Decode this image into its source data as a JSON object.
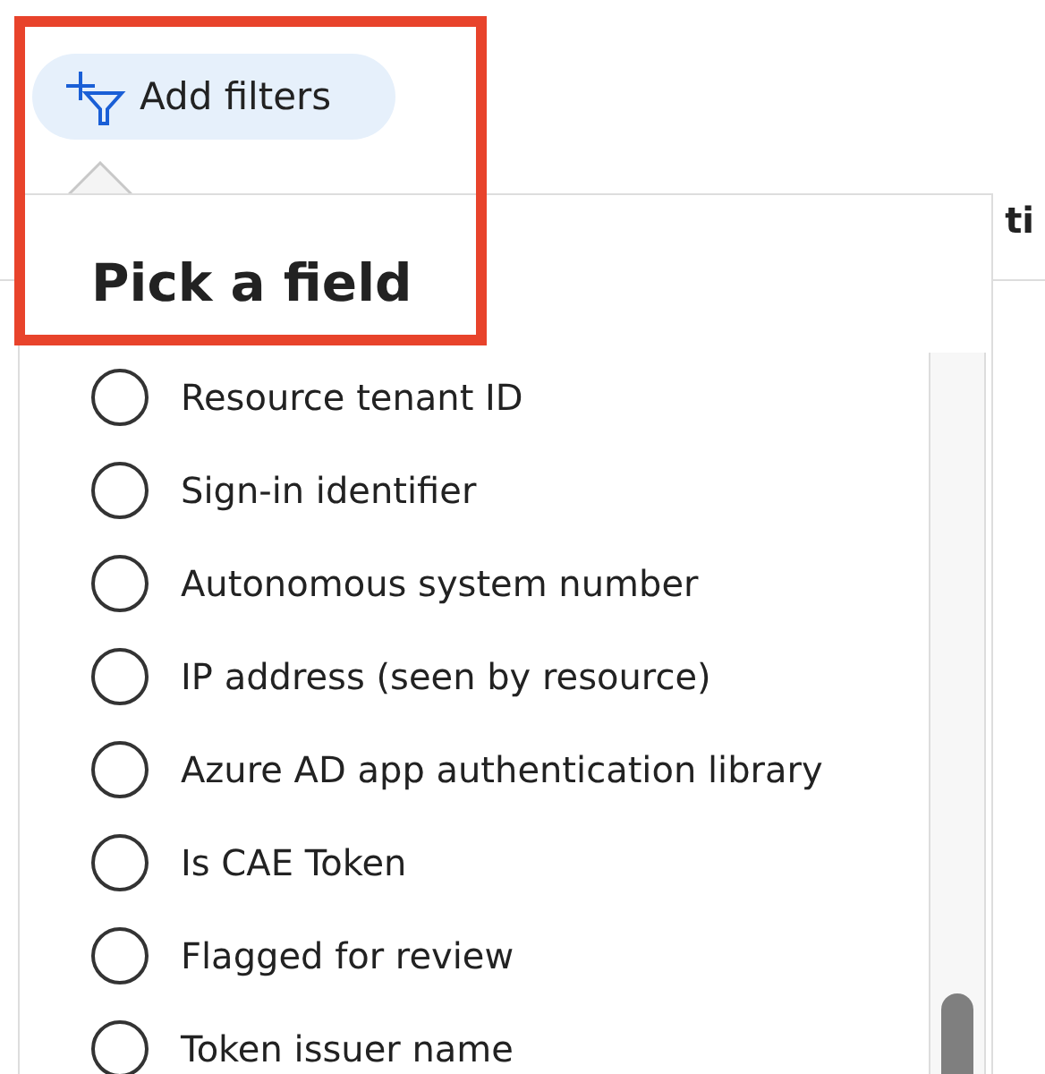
{
  "toolbar": {
    "add_filters_button": "Add filters"
  },
  "table": {
    "column_header": "ti"
  },
  "popup": {
    "title": "Pick a field",
    "options": [
      {
        "label": "Resource tenant ID",
        "selected": false
      },
      {
        "label": "Sign-in identifier",
        "selected": false
      },
      {
        "label": "Autonomous system number",
        "selected": false
      },
      {
        "label": "IP address (seen by resource)",
        "selected": false
      },
      {
        "label": "Azure AD app authentication library",
        "selected": false
      },
      {
        "label": "Is CAE Token",
        "selected": false
      },
      {
        "label": "Flagged for review",
        "selected": false
      },
      {
        "label": "Token issuer name",
        "selected": false
      }
    ]
  },
  "highlight": {
    "shown": true
  }
}
